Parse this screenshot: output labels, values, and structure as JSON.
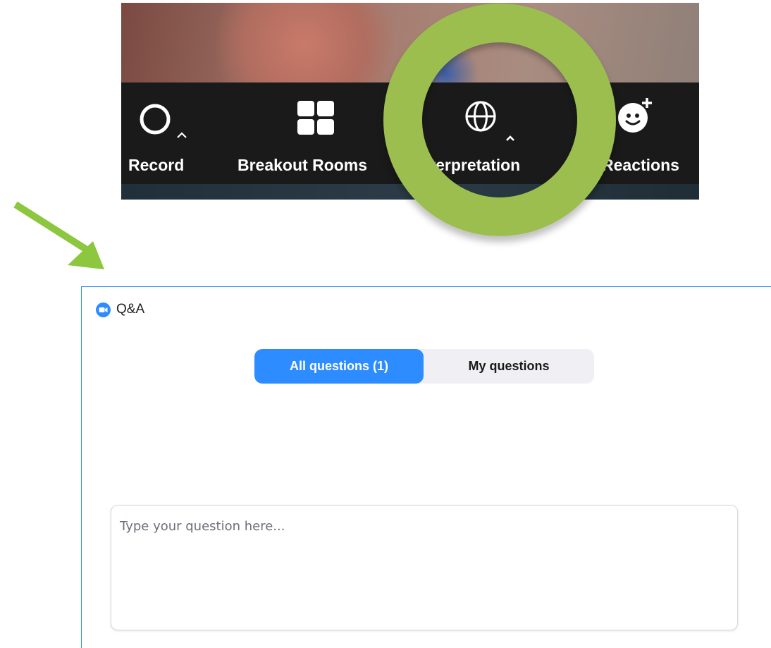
{
  "toolbar": {
    "buttons": [
      {
        "label": "Record",
        "icon": "record-icon"
      },
      {
        "label": "Breakout Rooms",
        "icon": "breakout-rooms-icon"
      },
      {
        "label": "Interpretation",
        "icon": "globe-icon"
      },
      {
        "label": "Reactions",
        "icon": "reaction-icon"
      }
    ]
  },
  "annotation": {
    "highlight_color": "#9bbe4f",
    "arrow_color": "#8dc63f"
  },
  "qa_panel": {
    "title": "Q&A",
    "logo_icon": "zoom-logo-icon",
    "tabs": {
      "all": "All questions  (1)",
      "mine": "My questions"
    },
    "input_placeholder": "Type your question here..."
  },
  "colors": {
    "accent": "#2d8cff",
    "toolbar_bg": "#1a1a1a"
  }
}
